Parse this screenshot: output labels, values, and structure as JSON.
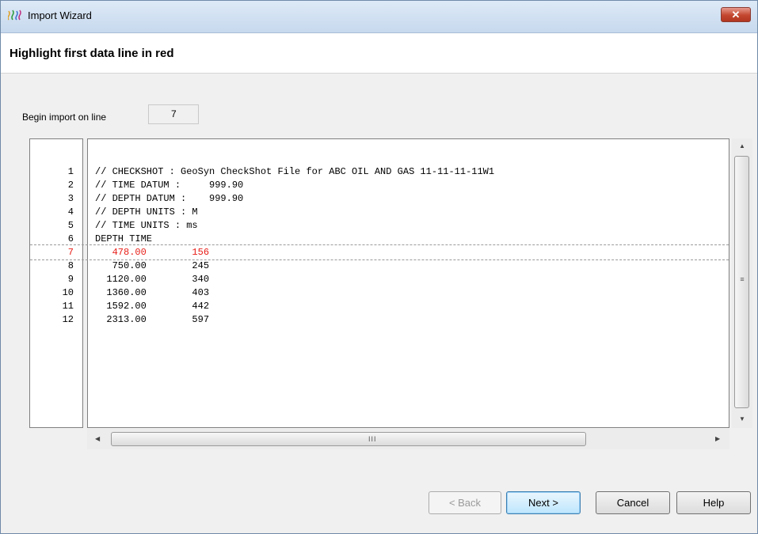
{
  "window": {
    "title": "Import Wizard",
    "close_label": "✕"
  },
  "header": {
    "title": "Highlight first data line in red"
  },
  "begin_import": {
    "label": "Begin import on line",
    "value": "7"
  },
  "line_numbers": [
    "1",
    "2",
    "3",
    "4",
    "5",
    "6",
    "7",
    "8",
    "9",
    "10",
    "11",
    "12"
  ],
  "lines": [
    "// CHECKSHOT : GeoSyn CheckShot File for ABC OIL AND GAS 11-11-11-11W1",
    "// TIME DATUM :     999.90",
    "// DEPTH DATUM :    999.90",
    "// DEPTH UNITS : M",
    "// TIME UNITS : ms",
    "DEPTH TIME",
    "   478.00        156",
    "   750.00        245",
    "  1120.00        340",
    "  1360.00        403",
    "  1592.00        442",
    "  2313.00        597"
  ],
  "highlight_line": 7,
  "highlight_color": "#e8201a",
  "buttons": {
    "back": "< Back",
    "next": "Next >",
    "cancel": "Cancel",
    "help": "Help"
  },
  "scrollbar": {
    "up": "▲",
    "down": "▼",
    "left": "◀",
    "right": "▶",
    "grip_h": "III",
    "grip_v": "≡"
  }
}
